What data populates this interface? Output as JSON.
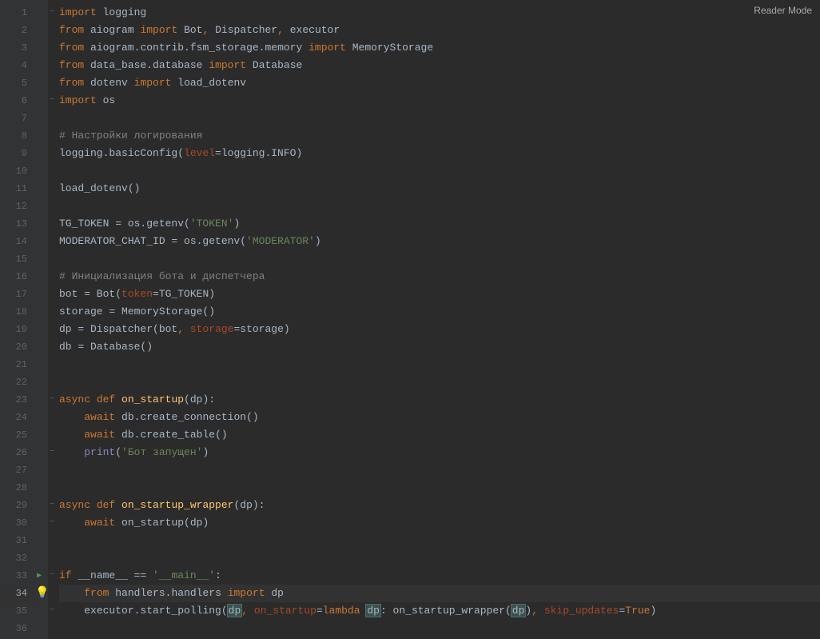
{
  "reader_mode": "Reader Mode",
  "gutter": {
    "lines": [
      "1",
      "2",
      "3",
      "4",
      "5",
      "6",
      "7",
      "8",
      "9",
      "10",
      "11",
      "12",
      "13",
      "14",
      "15",
      "16",
      "17",
      "18",
      "19",
      "20",
      "21",
      "22",
      "23",
      "24",
      "25",
      "26",
      "27",
      "28",
      "29",
      "30",
      "31",
      "32",
      "33",
      "34",
      "35",
      "36"
    ],
    "current_line": 34,
    "run_line": 33,
    "bulb_line": 34
  },
  "fold": {
    "1": "⊟",
    "2": "",
    "3": "",
    "4": "",
    "5": "",
    "6": "⊟",
    "7": "",
    "8": "",
    "9": "",
    "10": "",
    "11": "",
    "12": "",
    "13": "",
    "14": "",
    "15": "",
    "16": "",
    "17": "",
    "18": "",
    "19": "",
    "20": "",
    "21": "",
    "22": "",
    "23": "⊟",
    "24": "",
    "25": "",
    "26": "⊟",
    "27": "",
    "28": "",
    "29": "⊟",
    "30": "⊟",
    "31": "",
    "32": "",
    "33": "⊟",
    "34": "",
    "35": "⊟",
    "36": ""
  },
  "code": {
    "l1": {
      "kw1": "import",
      "sp": " ",
      "id": "logging"
    },
    "l2": {
      "kw1": "from",
      "sp1": " ",
      "m": "aiogram",
      "sp2": " ",
      "kw2": "import",
      "sp3": " ",
      "a": "Bot",
      "c1": ",",
      "sp4": " ",
      "b": "Dispatcher",
      "c2": ",",
      "sp5": " ",
      "c": "executor"
    },
    "l3": {
      "kw1": "from",
      "sp1": " ",
      "m": "aiogram.contrib.fsm_storage.memory",
      "sp2": " ",
      "kw2": "import",
      "sp3": " ",
      "a": "MemoryStorage"
    },
    "l4": {
      "kw1": "from",
      "sp1": " ",
      "m": "data_base.database",
      "sp2": " ",
      "kw2": "import",
      "sp3": " ",
      "a": "Database"
    },
    "l5": {
      "kw1": "from",
      "sp1": " ",
      "m": "dotenv",
      "sp2": " ",
      "kw2": "import",
      "sp3": " ",
      "a": "load_dotenv"
    },
    "l6": {
      "kw1": "import",
      "sp": " ",
      "id": "os"
    },
    "l7": "",
    "l8": {
      "c": "# Настройки логирования"
    },
    "l9": {
      "a": "logging.basicConfig(",
      "p": "level",
      "eq": "=logging.INFO)"
    },
    "l10": "",
    "l11": {
      "a": "load_dotenv()"
    },
    "l12": "",
    "l13": {
      "a": "TG_TOKEN = os.getenv(",
      "s": "'TOKEN'",
      "b": ")"
    },
    "l14": {
      "a": "MODERATOR_CHAT_ID = os.getenv(",
      "s": "'MODERATOR'",
      "b": ")"
    },
    "l15": "",
    "l16": {
      "c": "# Инициализация бота и диспетчера"
    },
    "l17": {
      "a": "bot = Bot(",
      "p": "token",
      "eq": "=TG_TOKEN)"
    },
    "l18": {
      "a": "storage = MemoryStorage()"
    },
    "l19": {
      "a": "dp = Dispatcher(bot",
      "c1": ",",
      "sp": " ",
      "p": "storage",
      "eq": "=storage)"
    },
    "l20": {
      "a": "db = Database()"
    },
    "l21": "",
    "l22": "",
    "l23": {
      "kw1": "async ",
      "kw2": "def ",
      "fn": "on_startup",
      "p": "(dp):"
    },
    "l24": {
      "ind": "    ",
      "kw": "await",
      "sp": " ",
      "a": "db.create_connection()"
    },
    "l25": {
      "ind": "    ",
      "kw": "await",
      "sp": " ",
      "a": "db.create_table()"
    },
    "l26": {
      "ind": "    ",
      "fn": "print",
      "p1": "(",
      "s": "'Бот запущен'",
      "p2": ")"
    },
    "l27": "",
    "l28": "",
    "l29": {
      "kw1": "async ",
      "kw2": "def ",
      "fn": "on_startup_wrapper",
      "p": "(dp):"
    },
    "l30": {
      "ind": "    ",
      "kw": "await",
      "sp": " ",
      "a": "on_startup(dp)"
    },
    "l31": "",
    "l32": "",
    "l33": {
      "kw": "if",
      "sp": " ",
      "a": "__name__ == ",
      "s": "'__main__'",
      "b": ":"
    },
    "l34": {
      "ind": "    ",
      "kw1": "from",
      "sp1": " ",
      "m": "handlers.handlers",
      "sp2": " ",
      "kw2": "import",
      "sp3": " ",
      "a": "dp"
    },
    "l35": {
      "ind": "    ",
      "a": "executor.start_polling(",
      "hl1": "dp",
      "c1": ",",
      "sp1": " ",
      "p1": "on_startup",
      "eq1": "=",
      "kw": "lambda",
      "sp2": " ",
      "hl2": "dp",
      "b": ": on_startup_wrapper(",
      "hl3": "dp",
      "c2": ")",
      "c3": ",",
      "sp3": " ",
      "p2": "skip_updates",
      "eq2": "=",
      "kw2": "True",
      "end": ")"
    },
    "l36": ""
  }
}
